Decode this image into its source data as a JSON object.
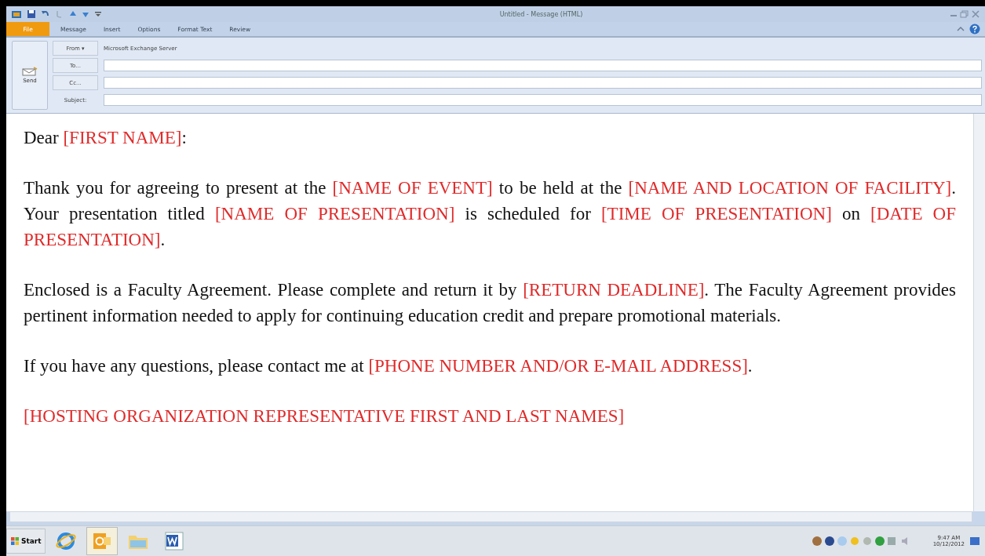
{
  "window": {
    "title": "Untitled - Message (HTML)"
  },
  "ribbon_tabs": [
    {
      "label": "File",
      "kind": "file"
    },
    {
      "label": "Message",
      "kind": "tab"
    },
    {
      "label": "Insert",
      "kind": "tab"
    },
    {
      "label": "Options",
      "kind": "tab"
    },
    {
      "label": "Format Text",
      "kind": "tab"
    },
    {
      "label": "Review",
      "kind": "tab"
    }
  ],
  "header": {
    "send": "Send",
    "from_button": "From ▾",
    "from_value": "Microsoft Exchange Server",
    "to_button": "To...",
    "cc_button": "Cc...",
    "subject_label": "Subject:"
  },
  "body": [
    [
      {
        "kind": "plain",
        "text": "Dear "
      },
      {
        "kind": "field",
        "text": "[FIRST NAME]"
      },
      {
        "kind": "plain",
        "text": ":"
      }
    ],
    [
      {
        "kind": "plain",
        "text": "Thank you for agreeing to present at the "
      },
      {
        "kind": "field",
        "text": "[NAME OF EVENT]"
      },
      {
        "kind": "plain",
        "text": " to be held at the "
      },
      {
        "kind": "field",
        "text": "[NAME AND LOCATION OF FACILITY]"
      },
      {
        "kind": "plain",
        "text": ". Your presentation titled "
      },
      {
        "kind": "field",
        "text": "[NAME OF PRESENTATION]"
      },
      {
        "kind": "plain",
        "text": " is scheduled for "
      },
      {
        "kind": "field",
        "text": "[TIME OF PRESENTATION]"
      },
      {
        "kind": "plain",
        "text": " on "
      },
      {
        "kind": "field",
        "text": "[DATE OF PRESENTATION]"
      },
      {
        "kind": "plain",
        "text": "."
      }
    ],
    [
      {
        "kind": "plain",
        "text": "Enclosed is a Faculty Agreement. Please complete and return it by "
      },
      {
        "kind": "field",
        "text": "[RETURN DEADLINE]"
      },
      {
        "kind": "plain",
        "text": ". The Faculty Agreement provides pertinent information needed to apply for continuing education credit and prepare promotional materials."
      }
    ],
    [
      {
        "kind": "plain",
        "text": "If you have any questions, please contact me at "
      },
      {
        "kind": "field",
        "text": "[PHONE NUMBER AND/OR E-MAIL ADDRESS]"
      },
      {
        "kind": "plain",
        "text": "."
      }
    ],
    [
      {
        "kind": "field",
        "text": "[HOSTING ORGANIZATION REPRESENTATIVE FIRST AND LAST NAMES]"
      }
    ]
  ],
  "taskbar": {
    "start": "Start",
    "apps": [
      {
        "kind": "browser",
        "selected": false
      },
      {
        "kind": "mail",
        "selected": true
      },
      {
        "kind": "folder",
        "selected": false
      },
      {
        "kind": "word",
        "selected": false
      }
    ],
    "time": "9:47 AM",
    "date": "10/12/2012"
  }
}
